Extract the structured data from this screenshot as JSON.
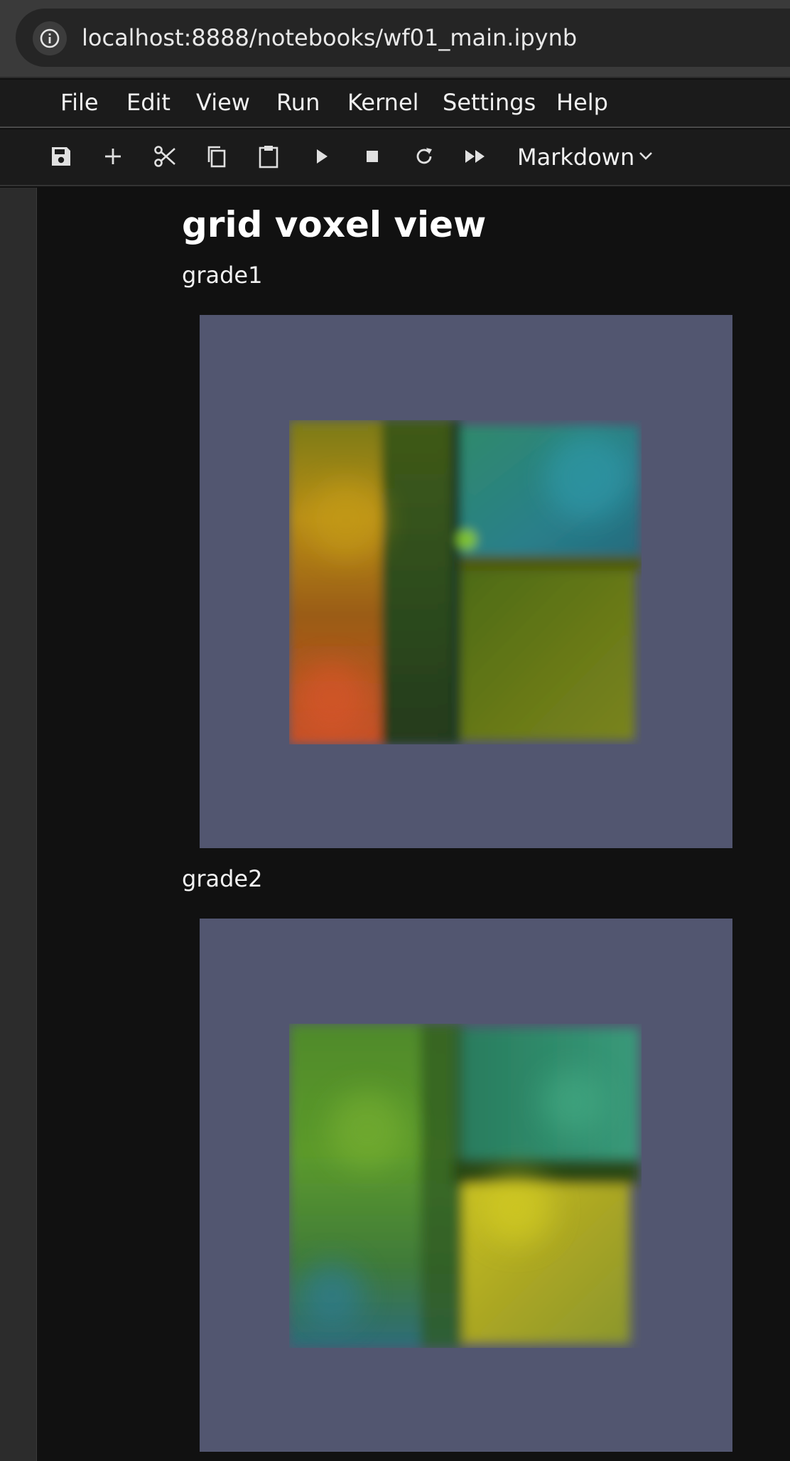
{
  "browser": {
    "url": "localhost:8888/notebooks/wf01_main.ipynb"
  },
  "menu": {
    "items": [
      "File",
      "Edit",
      "View",
      "Run",
      "Kernel",
      "Settings",
      "Help"
    ]
  },
  "toolbar": {
    "buttons": [
      "save-icon",
      "add-icon",
      "cut-icon",
      "copy-icon",
      "paste-icon",
      "run-icon",
      "stop-icon",
      "restart-icon",
      "fast-forward-icon"
    ],
    "cell_type": "Markdown"
  },
  "notebook": {
    "title": "grid voxel view",
    "sections": [
      {
        "label": "grade1"
      },
      {
        "label": "grade2"
      }
    ]
  },
  "colors": {
    "page_background": "#111111",
    "image_background": "#525670",
    "menu_background": "#1b1b1b"
  }
}
